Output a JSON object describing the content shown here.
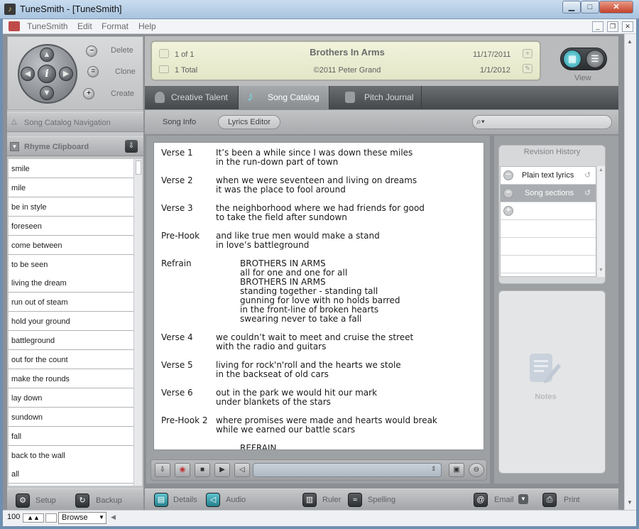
{
  "window": {
    "title": "TuneSmith - [TuneSmith]"
  },
  "menu": {
    "items": [
      "TuneSmith",
      "Edit",
      "Format",
      "Help"
    ]
  },
  "nav": {
    "delete": "Delete",
    "clone": "Clone",
    "create": "Create",
    "center": "i"
  },
  "song_card": {
    "index": "1 of 1",
    "total": "1 Total",
    "title": "Brothers In Arms",
    "copyright": "©2011 Peter Grand",
    "date1": "11/17/2011",
    "date2": "1/1/2012"
  },
  "view": {
    "label": "View"
  },
  "tabs": [
    "Creative Talent",
    "Song Catalog",
    "Pitch Journal"
  ],
  "left": {
    "nav_header": "Song Catalog Navigation",
    "clip_header": "Rhyme Clipboard",
    "rhymes": [
      "smile",
      "mile",
      "be in style",
      "foreseen",
      "come between",
      "to be seen",
      "living the dream",
      "run out of steam",
      "hold your ground",
      "battleground",
      "out for the count",
      "make the rounds",
      "lay down",
      "sundown",
      "fall",
      "back to the wall",
      "all"
    ],
    "setup": "Setup",
    "backup": "Backup"
  },
  "subtabs": {
    "song_info": "Song Info",
    "lyrics_editor": "Lyrics Editor"
  },
  "lyrics": [
    {
      "label": "Verse 1",
      "lines": [
        "It’s been a while since I was down these miles",
        "in the run-down part of town"
      ]
    },
    {
      "label": "Verse 2",
      "lines": [
        "when we were seventeen and living on dreams",
        "it was the place to fool around"
      ]
    },
    {
      "label": "Verse 3",
      "lines": [
        "the neighborhood where we had friends for good",
        "to take the field after sundown"
      ]
    },
    {
      "label": "Pre-Hook",
      "lines": [
        "and like true men would make a stand",
        "in love’s battleground"
      ]
    },
    {
      "label": "Refrain",
      "lines": [
        "BROTHERS IN ARMS",
        "all for one and one for all",
        "BROTHERS IN ARMS",
        "standing together - standing tall",
        "gunning for love with no holds barred",
        "in the front-line of broken hearts",
        "swearing never to take a fall"
      ]
    },
    {
      "label": "Verse 4",
      "lines": [
        "we couldn’t wait to meet and cruise the street",
        "with the radio and guitars"
      ]
    },
    {
      "label": "Verse 5",
      "lines": [
        "living for rock'n'roll and the hearts we stole",
        "in the backseat of old cars"
      ]
    },
    {
      "label": "Verse 6",
      "lines": [
        "out in the park we would hit our mark",
        "under blankets of the stars"
      ]
    },
    {
      "label": "Pre-Hook 2",
      "lines": [
        "where promises were made and hearts would break",
        "while we earned our battle scars"
      ]
    },
    {
      "label": "",
      "lines": [
        "REFRAIN"
      ]
    }
  ],
  "revision": {
    "title": "Revision History",
    "items": [
      "Plain text lyrics",
      "Song sections"
    ]
  },
  "notes": {
    "label": "Notes"
  },
  "toolbar": {
    "details": "Details",
    "audio": "Audio",
    "ruler": "Ruler",
    "spelling": "Spelling",
    "email": "Email",
    "print": "Print"
  },
  "status": {
    "zoom": "100",
    "mode": "Browse"
  }
}
